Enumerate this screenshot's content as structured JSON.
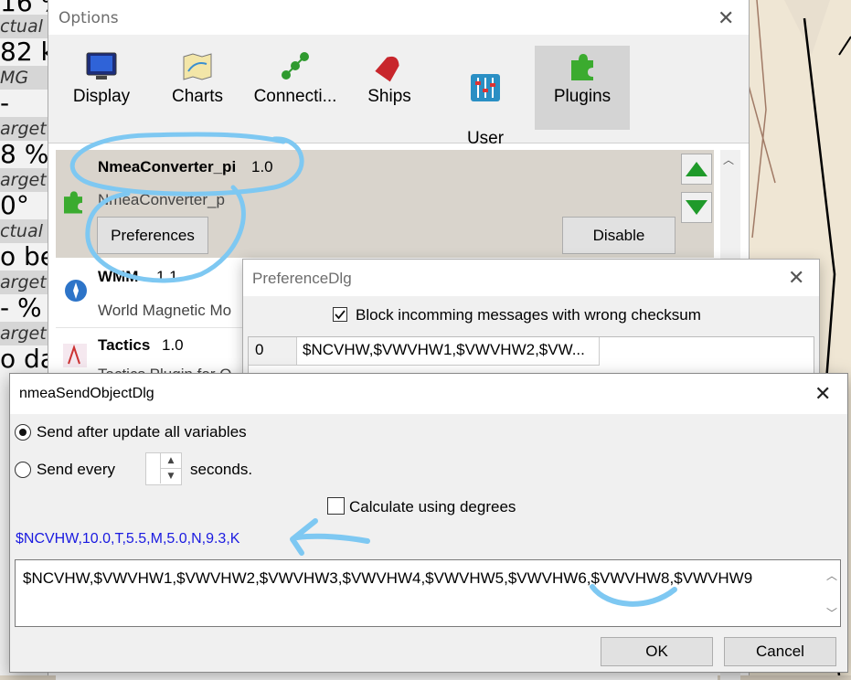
{
  "dashboard": {
    "labels": [
      "ctual V",
      "MG",
      "arget",
      "arget",
      "ctual C",
      "arget",
      "arget"
    ],
    "values": [
      "16 %",
      "82 k",
      "-",
      "8 %",
      "0°",
      "o be",
      "- %",
      "o da",
      "",
      "",
      "0"
    ]
  },
  "options": {
    "title": "Options",
    "toolbar": [
      {
        "label": "Display",
        "icon": "monitor-icon"
      },
      {
        "label": "Charts",
        "icon": "chart-map-icon"
      },
      {
        "label": "Connecti...",
        "icon": "connections-icon"
      },
      {
        "label": "Ships",
        "icon": "ship-icon"
      },
      {
        "label": "User\nInterface",
        "icon": "sliders-icon"
      },
      {
        "label": "Plugins",
        "icon": "puzzle-icon"
      }
    ],
    "selected_tab": "Plugins",
    "plugins": [
      {
        "name": "NmeaConverter_pi",
        "version": "1.0",
        "desc": "NmeaConverter_p",
        "preferences_label": "Preferences",
        "disable_label": "Disable"
      },
      {
        "name": "WMM",
        "version": "1.1",
        "desc": "World Magnetic Mo"
      },
      {
        "name": "Tactics",
        "version": "1.0",
        "desc": "Tactics Plugin for O"
      }
    ]
  },
  "preference_dlg": {
    "title": "PreferenceDlg",
    "checkbox_label": "Block incomming messages with wrong checksum",
    "checkbox_checked": true,
    "rows": [
      {
        "index": "0",
        "value": "$NCVHW,$VWVHW1,$VWVHW2,$VW..."
      }
    ]
  },
  "send_dlg": {
    "title": "nmeaSendObjectDlg",
    "radio_update_label": "Send after update all variables",
    "radio_every_label": "Send every",
    "seconds_label": "seconds.",
    "degrees_label": "Calculate using degrees",
    "result": "$NCVHW,10.0,T,5.5,M,5.0,N,9.3,K",
    "sequence": "$NCVHW,$VWVHW1,$VWVHW2,$VWVHW3,$VWVHW4,$VWVHW5,$VWVHW6,$VWVHW8,$VWVHW9",
    "ok_label": "OK",
    "cancel_label": "Cancel"
  },
  "colors": {
    "annotation": "#7ec8f2",
    "result_text": "#1a1ae0",
    "selected_tab": "#d4d4d4"
  }
}
